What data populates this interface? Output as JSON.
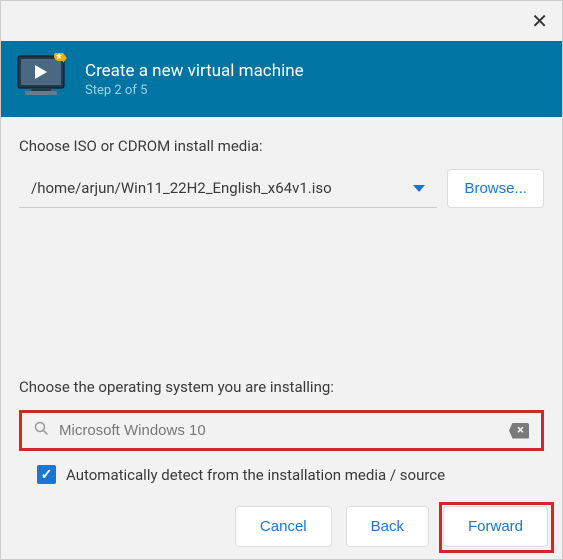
{
  "header": {
    "title": "Create a new virtual machine",
    "step": "Step 2 of 5"
  },
  "iso": {
    "label": "Choose ISO or CDROM install media:",
    "path": "/home/arjun/Win11_22H2_English_x64v1.iso",
    "browse": "Browse..."
  },
  "os": {
    "label": "Choose the operating system you are installing:",
    "search_value": "Microsoft Windows 10",
    "auto_label": "Automatically detect from the installation media / source"
  },
  "footer": {
    "cancel": "Cancel",
    "back": "Back",
    "forward": "Forward"
  }
}
